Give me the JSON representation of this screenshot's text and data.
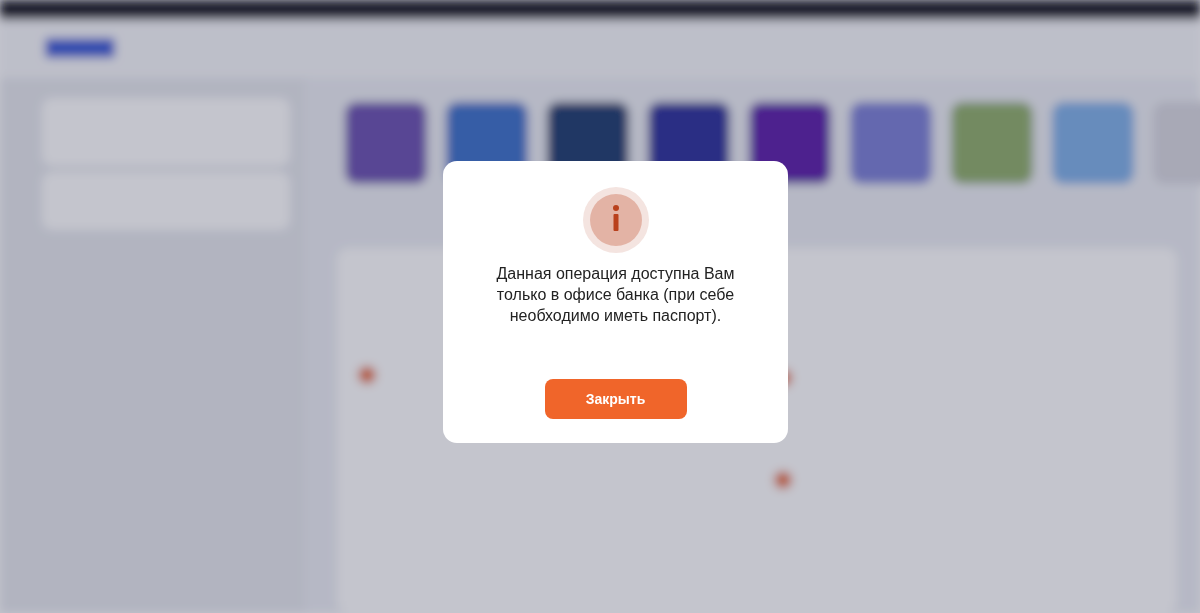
{
  "dialog": {
    "kind": "info",
    "message": "Данная операция доступна Вам только в офисе банка (при себе необходимо иметь паспорт).",
    "buttons": [
      "Закрыть"
    ]
  }
}
